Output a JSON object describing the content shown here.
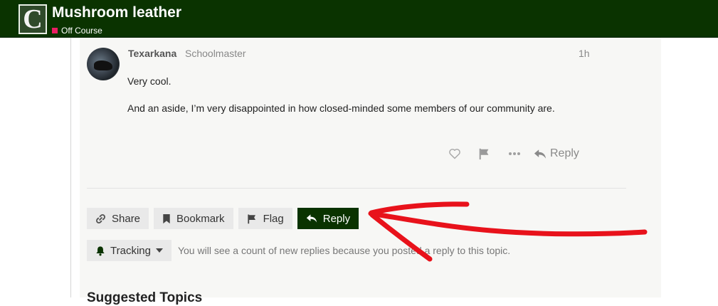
{
  "header": {
    "logo_letter": "C",
    "topic_title": "Mushroom leather",
    "category": "Off Course",
    "category_color": "#e91e63",
    "background_color": "#0a3300"
  },
  "post": {
    "username": "Texarkana",
    "user_title": "Schoolmaster",
    "age": "1h",
    "paragraphs": [
      "Very cool.",
      "And an aside, I’m very disappointed in how closed-minded some members of our community are."
    ],
    "actions": {
      "like_icon": "heart-icon",
      "flag_icon": "flag-icon",
      "more_icon": "ellipsis-icon",
      "reply_label": "Reply"
    }
  },
  "topic_footer": {
    "share_label": "Share",
    "bookmark_label": "Bookmark",
    "flag_label": "Flag",
    "reply_label": "Reply",
    "tracking_label": "Tracking",
    "tracking_description": "You will see a count of new replies because you posted a reply to this topic."
  },
  "suggested_heading": "Suggested Topics",
  "annotation_color": "#e8121b"
}
